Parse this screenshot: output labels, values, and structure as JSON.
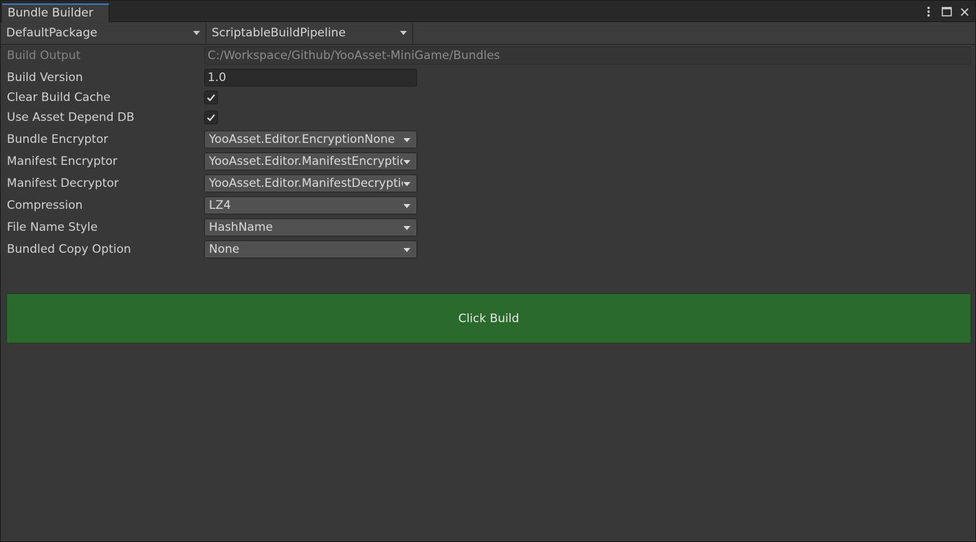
{
  "window": {
    "tab_title": "Bundle Builder",
    "controls": [
      "kebab-menu-icon",
      "maximize-icon",
      "close-icon"
    ]
  },
  "toolbar": {
    "package": "DefaultPackage",
    "pipeline": "ScriptableBuildPipeline"
  },
  "form": {
    "build_output": {
      "label": "Build Output",
      "value": "C:/Workspace/Github/YooAsset-MiniGame/Bundles"
    },
    "build_version": {
      "label": "Build Version",
      "value": "1.0"
    },
    "clear_build_cache": {
      "label": "Clear Build Cache",
      "checked": true
    },
    "use_asset_depend_db": {
      "label": "Use Asset Depend DB",
      "checked": true
    },
    "bundle_encryptor": {
      "label": "Bundle Encryptor",
      "value": "YooAsset.Editor.EncryptionNone"
    },
    "manifest_encryptor": {
      "label": "Manifest Encryptor",
      "value": "YooAsset.Editor.ManifestEncryptionNone"
    },
    "manifest_decryptor": {
      "label": "Manifest Decryptor",
      "value": "YooAsset.Editor.ManifestDecryptionNone"
    },
    "compression": {
      "label": "Compression",
      "value": "LZ4"
    },
    "file_name_style": {
      "label": "File Name Style",
      "value": "HashName"
    },
    "bundled_copy_option": {
      "label": "Bundled Copy Option",
      "value": "None"
    }
  },
  "build_button": {
    "label": "Click Build",
    "color": "#2a6a2c"
  }
}
